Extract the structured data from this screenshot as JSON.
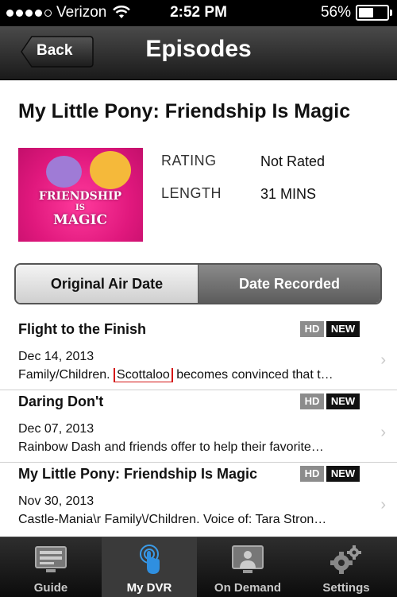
{
  "status_bar": {
    "carrier": "Verizon",
    "time": "2:52 PM",
    "battery": "56%",
    "battery_level": 0.56,
    "signal_bars_filled": 4
  },
  "navbar": {
    "back_label": "Back",
    "title": "Episodes"
  },
  "show": {
    "title": "My Little Pony: Friendship Is Magic",
    "poster_text": [
      "FRIENDSHIP",
      "IS",
      "MAGIC"
    ],
    "rating_label": "RATING",
    "rating_value": "Not Rated",
    "length_label": "LENGTH",
    "length_value": "31 MINS"
  },
  "sort": {
    "options": [
      "Original Air Date",
      "Date Recorded"
    ],
    "selected": "Date Recorded"
  },
  "episodes": [
    {
      "title": "Flight to the Finish",
      "hd": "HD",
      "new": "NEW",
      "date": "Dec 14, 2013",
      "desc_prefix": "Family/Children.",
      "desc_highlight": "Scottaloo",
      "desc_suffix": "becomes convinced that t…"
    },
    {
      "title": "Daring Don't",
      "hd": "HD",
      "new": "NEW",
      "date": "Dec 07, 2013",
      "desc": "Rainbow Dash and friends offer to help their favorite…"
    },
    {
      "title": "My Little Pony: Friendship Is Magic",
      "hd": "HD",
      "new": "NEW",
      "date": "Nov 30, 2013",
      "desc": "Castle-Mania\\r Family\\/Children. Voice of: Tara Stron…"
    }
  ],
  "tabs": [
    {
      "label": "Guide",
      "icon": "tv-guide-icon"
    },
    {
      "label": "My DVR",
      "icon": "touch-hand-icon",
      "active": true
    },
    {
      "label": "On Demand",
      "icon": "presenter-screen-icon"
    },
    {
      "label": "Settings",
      "icon": "gears-icon"
    }
  ],
  "colors": {
    "highlight_box": "#d41515",
    "poster_pink": "#e0187d"
  }
}
